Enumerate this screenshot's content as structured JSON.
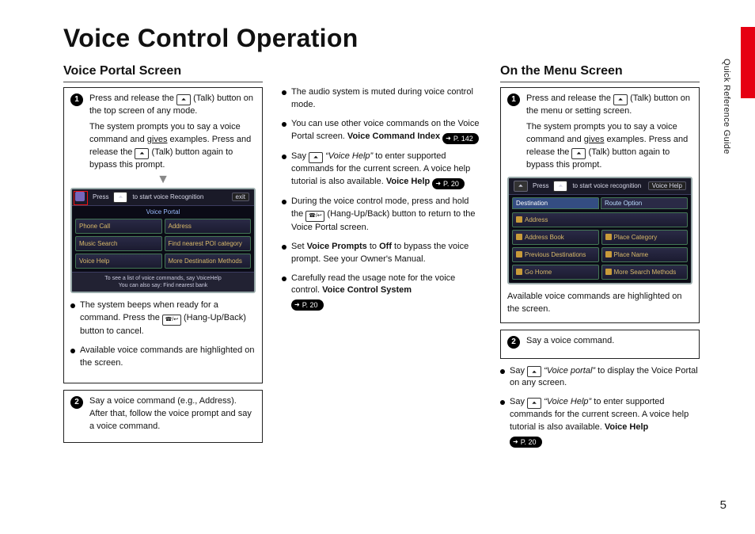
{
  "page_title": "Voice Control Operation",
  "side_label": "Quick Reference Guide",
  "page_number": "5",
  "col1": {
    "heading": "Voice Portal Screen",
    "step1a": "Press and release the ",
    "step1b": " (Talk) button on the top screen of any mode.",
    "step1c_a": "The system prompts you to say a voice command and ",
    "step1c_u": "gives",
    "step1c_b": " examples. Press and release the ",
    "step1c_c": " (Talk) button again to bypass this prompt.",
    "b1a": "The system beeps when ready for a command. Press the ",
    "b1b": " (Hang-Up/Back) button to cancel.",
    "b2": "Available voice commands are highlighted on the screen.",
    "step2": "Say a voice command (e.g., Address). After that, follow the voice prompt and say a voice command."
  },
  "device1": {
    "topbar_a": "Press",
    "topbar_b": "to start voice Recognition",
    "topbar_exit": "exit",
    "title": "Voice Portal",
    "items": [
      "Phone Call",
      "Address",
      "Music Search",
      "Find nearest POI category",
      "Voice Help",
      "More Destination Methods"
    ],
    "foot1": "To see a list of voice commands, say VoiceHelp",
    "foot2": "You can also say: Find nearest bank"
  },
  "col2": {
    "b1": "The audio system is muted during voice control mode.",
    "b2a": "You can use other voice commands on the Voice Portal screen. ",
    "b2_bold": "Voice Command Index",
    "b2_ref": "P. 142",
    "b3a": "Say ",
    "b3q": "“Voice Help”",
    "b3b": " to enter supported commands for the current screen. A voice help tutorial is also available. ",
    "b3_bold": "Voice Help",
    "b3_ref": "P. 20",
    "b4a": "During the voice control mode, press and hold the ",
    "b4b": " (Hang-Up/Back) button to return to the Voice Portal screen.",
    "b5a": "Set ",
    "b5_bold1": "Voice Prompts",
    "b5b": " to ",
    "b5_bold2": "Off",
    "b5c": " to bypass the voice prompt. See your Owner's Manual.",
    "b6a": "Carefully read the usage note for the voice control. ",
    "b6_bold": "Voice Control System",
    "b6_ref": "P. 20"
  },
  "col3": {
    "heading": "On the Menu Screen",
    "step1a": "Press and release the ",
    "step1b": " (Talk) button on the menu or setting screen.",
    "step1c_a": "The system prompts you to say a voice command and ",
    "step1c_u": "gives",
    "step1c_b": " examples. Press and release the ",
    "step1c_c": " (Talk) button again to bypass this prompt.",
    "caption": "Available voice commands are highlighted on the screen.",
    "step2": "Say a voice command.",
    "b1a": "Say ",
    "b1q": "“Voice portal”",
    "b1b": " to display the Voice Portal on any screen.",
    "b2a": "Say ",
    "b2q": "“Voice Help”",
    "b2b": " to enter supported commands for the current screen. A voice help tutorial is also available. ",
    "b2_bold": "Voice Help",
    "b2_ref": "P. 20"
  },
  "device2": {
    "topbar_a": "Press",
    "topbar_b": "to start voice recognition",
    "topbar_help": "Voice Help",
    "tab1": "Destination",
    "tab2": "Route Option",
    "items": [
      "Address",
      "Address Book",
      "Place Category",
      "Previous Destinations",
      "Place Name",
      "Go Home",
      "More Search Methods"
    ]
  }
}
